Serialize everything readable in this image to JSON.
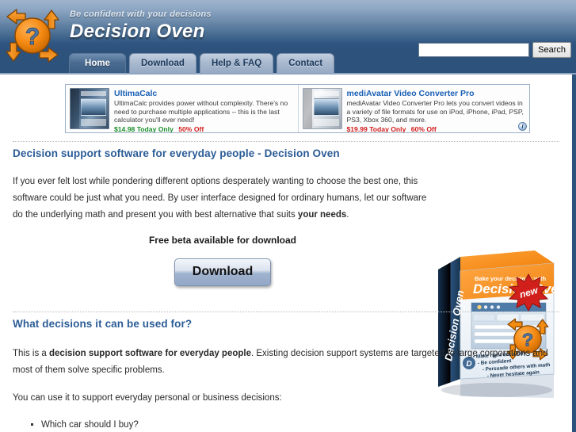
{
  "header": {
    "tagline": "Be confident with your decisions",
    "site_title": "Decision Oven",
    "logo_name": "decision-oven-arrows-question-logo",
    "nav": [
      {
        "label": "Home",
        "active": true
      },
      {
        "label": "Download",
        "active": false
      },
      {
        "label": "Help & FAQ",
        "active": false
      },
      {
        "label": "Contact",
        "active": false
      }
    ],
    "search": {
      "value": "",
      "placeholder": "",
      "button_label": "Search"
    },
    "colors": {
      "header_top": "#9fb4ce",
      "header_bottom": "#2d527c",
      "tab_active_bg": "#4b6c91",
      "tab_inactive_bg": "#a9bacf"
    }
  },
  "ads": {
    "info_icon": "i",
    "items": [
      {
        "title": "UltimaCalc",
        "description": "UltimaCalc provides power without complexity. There's no need to purchase multiple applications -- this is the last calculator you'll ever need!",
        "price": "$14.98",
        "terms": "Today Only",
        "discount": "50% Off"
      },
      {
        "title": "mediAvatar Video Converter Pro",
        "description": "mediAvatar Video Converter Pro lets you convert videos in a variety of file formats for use on iPod, iPhone, iPad, PSP, PS3, Xbox 360, and more.",
        "price": "$19.99",
        "terms": "Today Only",
        "discount": "60% Off"
      }
    ]
  },
  "main": {
    "section1": {
      "heading": "Decision support software for everyday people - Decision Oven",
      "paragraph_part1": "If you ever felt lost while pondering different options desperately wanting to choose the best one, this software could be just what you need. By user interface designed for ordinary humans, let our software do the underlying math and present you with best alternative that suits ",
      "paragraph_bold": "your needs",
      "paragraph_part2": ".",
      "cta_text": "Free beta available for download",
      "download_label": "Download"
    },
    "section2": {
      "heading": "What decisions it can be used for?",
      "p1_part1": "This is a ",
      "p1_bold": "decision support software for everyday people",
      "p1_part2": ". Existing decision support systems are targeted to large corporations and most of them solve specific problems.",
      "p2": "You can use it to support everyday personal or business decisions:",
      "bullets": [
        "Which car should I buy?"
      ]
    }
  },
  "product_box": {
    "kicker": "Bake your decisions with",
    "title": "Decision Oven",
    "spine_title": "Decision Oven",
    "badge": "new",
    "features": [
      "Make right decisions",
      "Be confident",
      "Persuade others with math",
      "Never hesitate again"
    ]
  }
}
